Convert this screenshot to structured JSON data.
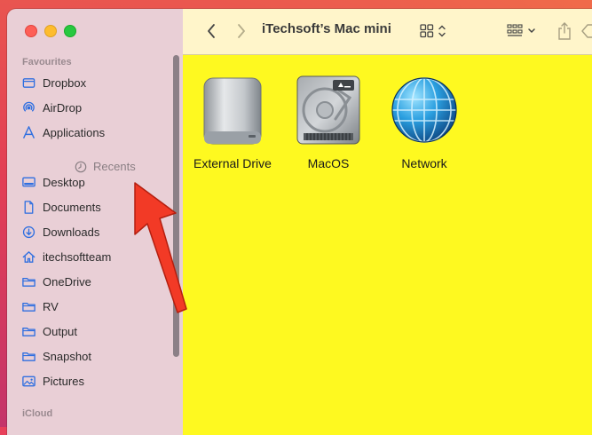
{
  "window": {
    "title": "iTechsoft’s Mac mini"
  },
  "sidebar": {
    "favourites_label": "Favourites",
    "icloud_label": "iCloud",
    "recents_label": "Recents",
    "items": [
      {
        "label": "Dropbox",
        "icon": "dropbox-icon"
      },
      {
        "label": "AirDrop",
        "icon": "airdrop-icon"
      },
      {
        "label": "Applications",
        "icon": "applications-icon"
      },
      {
        "label": "Desktop",
        "icon": "desktop-icon"
      },
      {
        "label": "Documents",
        "icon": "document-icon"
      },
      {
        "label": "Downloads",
        "icon": "download-icon"
      },
      {
        "label": "itechsoftteam",
        "icon": "home-icon"
      },
      {
        "label": "OneDrive",
        "icon": "folder-icon"
      },
      {
        "label": "RV",
        "icon": "folder-icon"
      },
      {
        "label": "Output",
        "icon": "folder-icon"
      },
      {
        "label": "Snapshot",
        "icon": "folder-icon"
      },
      {
        "label": "Pictures",
        "icon": "pictures-icon"
      }
    ]
  },
  "files": [
    {
      "label": "External Drive",
      "icon": "external-drive-icon"
    },
    {
      "label": "MacOS",
      "icon": "internal-disk-icon"
    },
    {
      "label": "Network",
      "icon": "network-globe-icon"
    }
  ],
  "colors": {
    "content_bg": "#fef920",
    "sidebar_bg": "#e9cfd6",
    "toolbar_bg": "#fff5ca",
    "accent": "#2f6fe0",
    "annotation_arrow": "#f23a26"
  }
}
